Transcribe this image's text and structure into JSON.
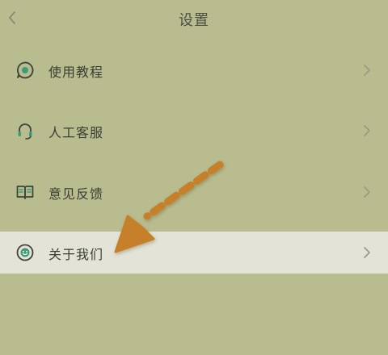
{
  "header": {
    "title": "设置",
    "back_icon": "chevron-left-icon"
  },
  "menu": [
    {
      "label": "使用教程",
      "icon": "tutorial-icon",
      "highlighted": false
    },
    {
      "label": "人工客服",
      "icon": "headset-icon",
      "highlighted": false
    },
    {
      "label": "意见反馈",
      "icon": "book-icon",
      "highlighted": false
    },
    {
      "label": "关于我们",
      "icon": "smiley-icon",
      "highlighted": true
    }
  ],
  "colors": {
    "background": "#b9bc8f",
    "highlight_row": "#e4e3d8",
    "accent_icon": "#3d9b78",
    "annotation_arrow": "#c7802a"
  },
  "annotation": {
    "type": "dashed-arrow",
    "points_to": "关于我们"
  }
}
